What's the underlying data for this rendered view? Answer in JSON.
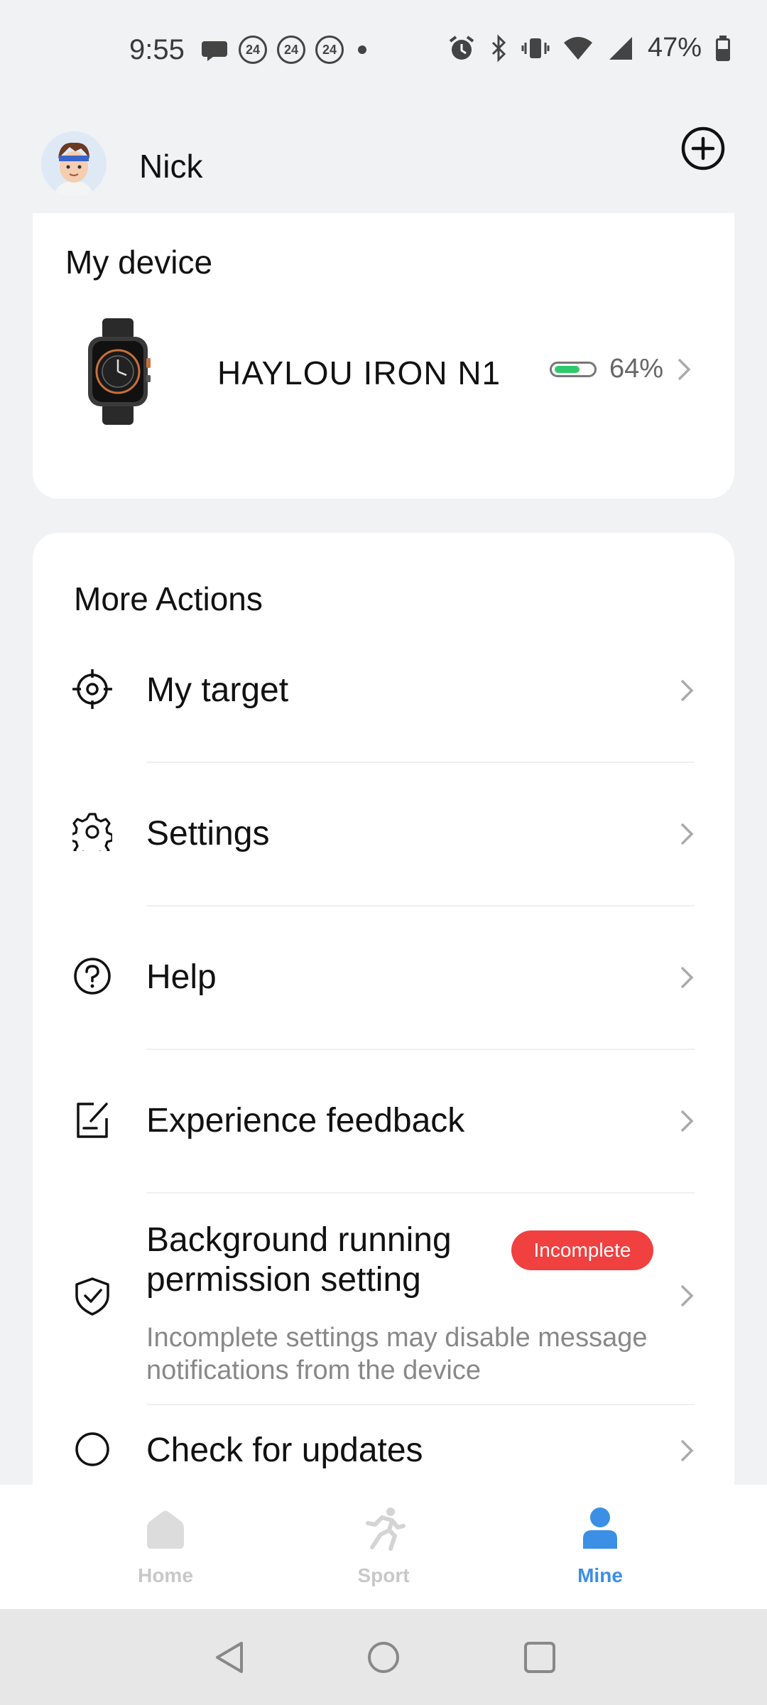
{
  "status_bar": {
    "time": "9:55",
    "badges": [
      "24",
      "24",
      "24"
    ],
    "battery_percent": "47%"
  },
  "header": {
    "user_name": "Nick"
  },
  "device": {
    "section_title": "My device",
    "name": "HAYLOU IRON N1",
    "battery": "64%",
    "battery_level": 0.64,
    "battery_color": "#2fc96c"
  },
  "actions": {
    "title": "More Actions",
    "items": [
      {
        "label": "My target",
        "icon": "target-icon"
      },
      {
        "label": "Settings",
        "icon": "gear-icon"
      },
      {
        "label": "Help",
        "icon": "help-icon"
      },
      {
        "label": "Experience feedback",
        "icon": "feedback-icon"
      },
      {
        "label": "Background running\npermission setting",
        "icon": "shield-check-icon",
        "badge": "Incomplete",
        "subtitle": "Incomplete settings may disable message notifications from the device"
      },
      {
        "label": "Check for updates",
        "icon": "update-icon"
      }
    ]
  },
  "tabs": [
    {
      "label": "Home",
      "active": false
    },
    {
      "label": "Sport",
      "active": false
    },
    {
      "label": "Mine",
      "active": true
    }
  ],
  "colors": {
    "accent": "#3b8fe5",
    "badge": "#f04040",
    "background": "#f1f2f4"
  }
}
